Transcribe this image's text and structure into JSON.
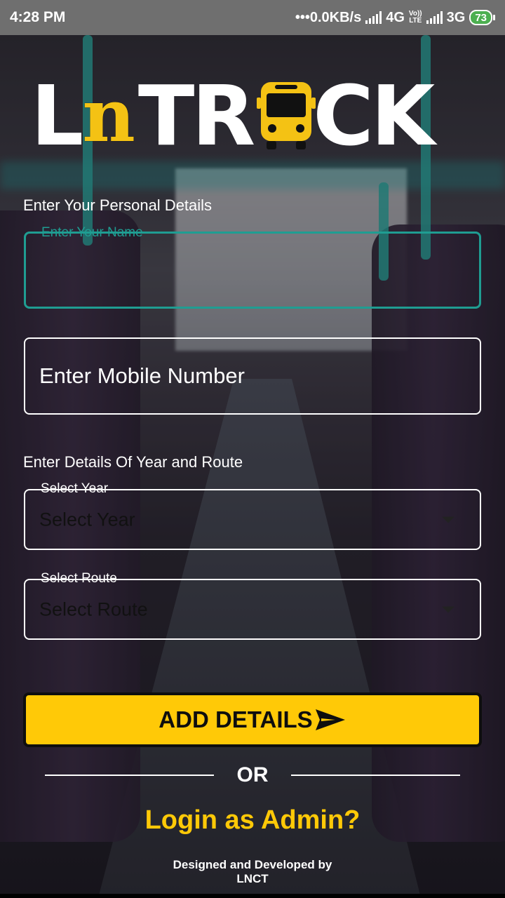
{
  "status_bar": {
    "time": "4:28 PM",
    "network_speed": "•••0.0KB/s",
    "network1": "4G",
    "volte_top": "Vo))",
    "volte_bottom": "LTE",
    "network2": "3G",
    "battery": "73"
  },
  "logo": {
    "part1": "L",
    "part2": "n",
    "part3": "TR",
    "part4": "CK"
  },
  "personal_section": {
    "heading": "Enter Your Personal Details",
    "name_label": "Enter Your Name",
    "mobile_placeholder": "Enter Mobile Number"
  },
  "route_section": {
    "heading": "Enter Details Of Year and Route",
    "year_label": "Select Year",
    "year_value": "Select Year",
    "route_label": "Select Route",
    "route_value": "Select Route"
  },
  "actions": {
    "add_details": "ADD DETAILS",
    "or": "OR",
    "login_admin": "Login as Admin?"
  },
  "footer": {
    "line1": "Designed and Developed by",
    "line2": "LNCT"
  },
  "colors": {
    "accent": "#ffc907",
    "focus": "#1f9d92",
    "battery": "#4caf50"
  }
}
